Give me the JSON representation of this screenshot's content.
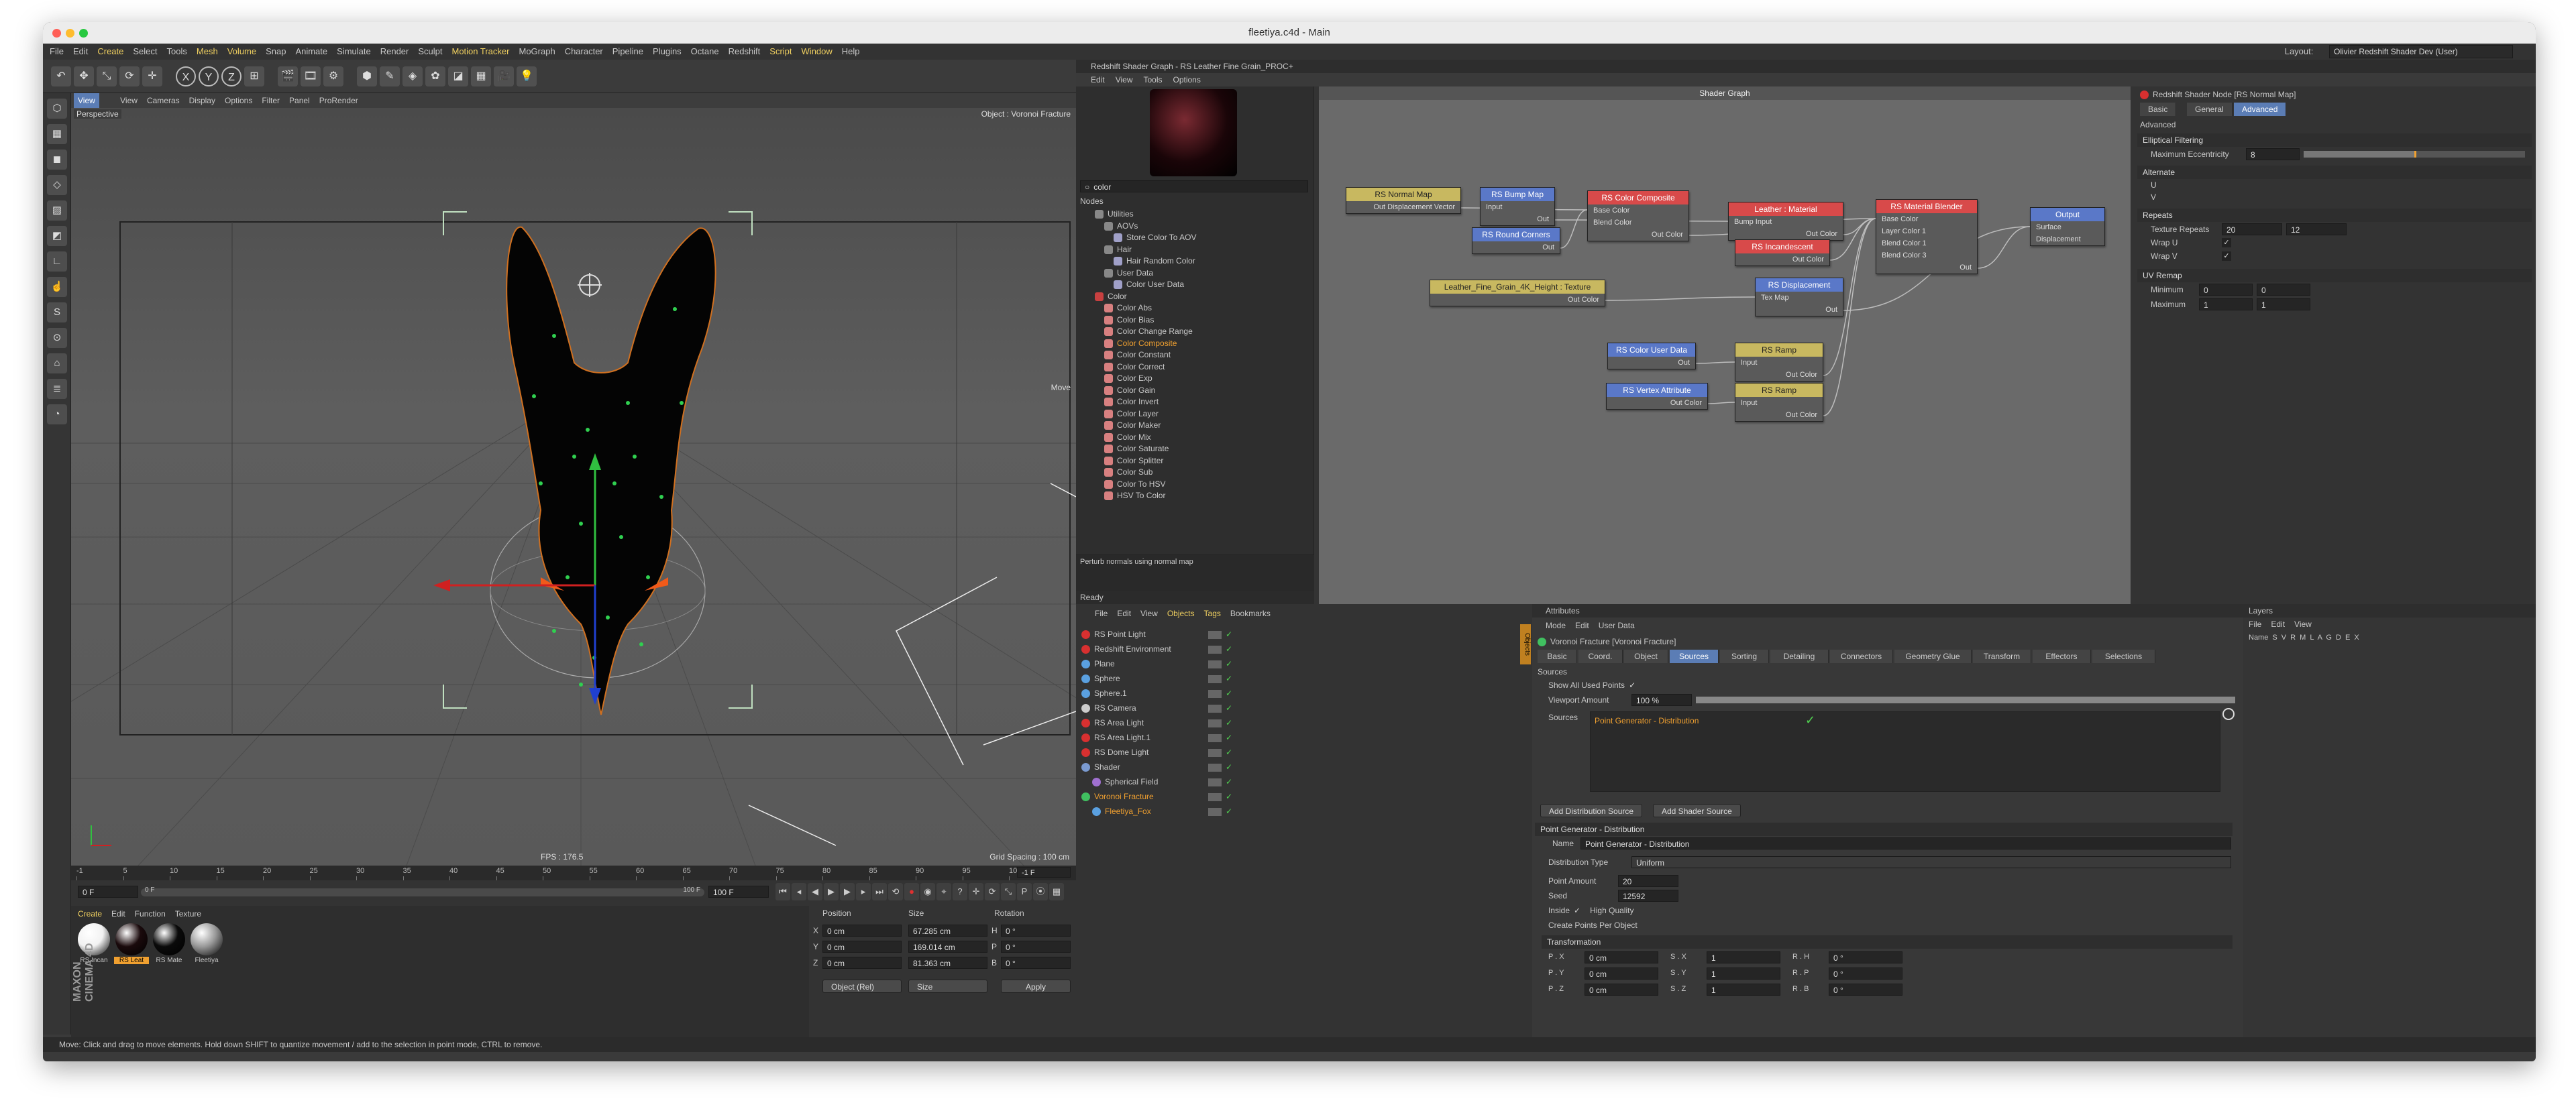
{
  "window": {
    "title": "fleetiya.c4d - Main",
    "layout_label": "Layout:",
    "layout_value": "Olivier Redshift Shader Dev (User)"
  },
  "menubar": [
    "File",
    "Edit",
    "Create",
    "Select",
    "Tools",
    "Mesh",
    "Volume",
    "Snap",
    "Animate",
    "Simulate",
    "Render",
    "Sculpt",
    "Motion Tracker",
    "MoGraph",
    "Character",
    "Pipeline",
    "Plugins",
    "Octane",
    "Redshift",
    "Script",
    "Window",
    "Help"
  ],
  "toolbar_icons": [
    "undo-icon",
    "move-icon",
    "scale-icon",
    "rotate-icon",
    "transform-icon",
    "x-axis-icon",
    "y-axis-icon",
    "z-axis-icon",
    "coordinate-icon",
    "render-view-icon",
    "render-pv-icon",
    "render-settings-icon",
    "cube-icon",
    "pen-icon",
    "subdivide-icon",
    "cloner-icon",
    "deformer-icon",
    "floor-icon",
    "camera-icon",
    "light-icon"
  ],
  "toolbar_glyphs": [
    "↶",
    "✥",
    "⤡",
    "⟳",
    "✛",
    "X",
    "Y",
    "Z",
    "⊞",
    "🎬",
    "🎞",
    "⚙",
    "⬢",
    "✎",
    "◈",
    "✿",
    "◪",
    "▦",
    "🎥",
    "💡"
  ],
  "viewport": {
    "view_tab": "View",
    "menus": [
      "View",
      "Cameras",
      "Display",
      "Options",
      "Filter",
      "Panel",
      "ProRender"
    ],
    "name": "Perspective",
    "object_label": "Object : Voronoi Fracture",
    "move_label": "Move",
    "fps": "FPS : 176.5",
    "grid_spacing": "Grid Spacing : 100 cm"
  },
  "timeline": {
    "ticks": [
      "-1",
      "5",
      "10",
      "15",
      "20",
      "25",
      "30",
      "35",
      "40",
      "45",
      "50",
      "55",
      "60",
      "65",
      "70",
      "75",
      "80",
      "85",
      "90",
      "95",
      "100"
    ],
    "current_frame": "-1 F",
    "start": "0 F",
    "range_start": "0 F",
    "range_end": "100 F",
    "end": "100 F"
  },
  "materials": {
    "menus": [
      "Create",
      "Edit",
      "Function",
      "Texture"
    ],
    "items": [
      {
        "name": "RS Incan",
        "color": "#f2f2f2"
      },
      {
        "name": "RS Leat",
        "color": "#1a0a0c"
      },
      {
        "name": "RS Mate",
        "color": "#0a0a0a"
      },
      {
        "name": "Fleetiya",
        "color": "#999999"
      }
    ]
  },
  "coordinates": {
    "headers": [
      "Position",
      "Size",
      "Rotation"
    ],
    "rows": [
      {
        "axis": "X",
        "pos": "0 cm",
        "size": "67.285 cm",
        "rot_label": "H",
        "rot": "0 °"
      },
      {
        "axis": "Y",
        "pos": "0 cm",
        "size": "169.014 cm",
        "rot_label": "P",
        "rot": "0 °"
      },
      {
        "axis": "Z",
        "pos": "0 cm",
        "size": "81.363 cm",
        "rot_label": "B",
        "rot": "0 °"
      }
    ],
    "mode": "Object (Rel)",
    "size_mode": "Size",
    "apply": "Apply"
  },
  "status": "Move: Click and drag to move elements. Hold down SHIFT to quantize movement / add to the selection in point mode, CTRL to remove.",
  "brand": "MAXON CINEMA 4D",
  "shader_graph": {
    "title": "Redshift Shader Graph - RS Leather Fine Grain_PROC+",
    "menus": [
      "Edit",
      "View",
      "Tools",
      "Options"
    ],
    "search": "color",
    "nodes_header": "Nodes",
    "tree": [
      {
        "label": "Utilities",
        "level": 1,
        "color": "#888888"
      },
      {
        "label": "AOVs",
        "level": 2,
        "color": "#888888"
      },
      {
        "label": "Store Color To AOV",
        "level": 3,
        "color": "#a0a0c8"
      },
      {
        "label": "Hair",
        "level": 2,
        "color": "#888888"
      },
      {
        "label": "Hair Random Color",
        "level": 3,
        "color": "#a0a0c8"
      },
      {
        "label": "User Data",
        "level": 2,
        "color": "#888888"
      },
      {
        "label": "Color User Data",
        "level": 3,
        "color": "#a0a0c8"
      },
      {
        "label": "Color",
        "level": 1,
        "color": "#c84040"
      },
      {
        "label": "Color Abs",
        "level": 2,
        "color": "#d88080"
      },
      {
        "label": "Color Bias",
        "level": 2,
        "color": "#d88080"
      },
      {
        "label": "Color Change Range",
        "level": 2,
        "color": "#d88080"
      },
      {
        "label": "Color Composite",
        "level": 2,
        "color": "#d88080",
        "active": true
      },
      {
        "label": "Color Constant",
        "level": 2,
        "color": "#d88080"
      },
      {
        "label": "Color Correct",
        "level": 2,
        "color": "#d88080"
      },
      {
        "label": "Color Exp",
        "level": 2,
        "color": "#d88080"
      },
      {
        "label": "Color Gain",
        "level": 2,
        "color": "#d88080"
      },
      {
        "label": "Color Invert",
        "level": 2,
        "color": "#d88080"
      },
      {
        "label": "Color Layer",
        "level": 2,
        "color": "#d88080"
      },
      {
        "label": "Color Maker",
        "level": 2,
        "color": "#d88080"
      },
      {
        "label": "Color Mix",
        "level": 2,
        "color": "#d88080"
      },
      {
        "label": "Color Saturate",
        "level": 2,
        "color": "#d88080"
      },
      {
        "label": "Color Splitter",
        "level": 2,
        "color": "#d88080"
      },
      {
        "label": "Color Sub",
        "level": 2,
        "color": "#d88080"
      },
      {
        "label": "Color To HSV",
        "level": 2,
        "color": "#d88080"
      },
      {
        "label": "HSV To Color",
        "level": 2,
        "color": "#d88080"
      }
    ],
    "description": "Perturb normals using normal map",
    "ready": "Ready",
    "graph_title": "Shader Graph",
    "nodes": [
      {
        "title": "RS Normal Map",
        "color": "#c8b860",
        "inputs": [],
        "outputs": [
          "Out Displacement Vector"
        ]
      },
      {
        "title": "RS Bump Map",
        "color": "#5a78c8",
        "inputs": [
          "Input"
        ],
        "outputs": [
          "Out"
        ]
      },
      {
        "title": "RS Round Corners",
        "color": "#5a78c8",
        "inputs": [],
        "outputs": [
          "Out"
        ]
      },
      {
        "title": "RS Color Composite",
        "color": "#d84a4a",
        "inputs": [
          "Base Color",
          "Blend Color"
        ],
        "outputs": [
          "Out Color"
        ]
      },
      {
        "title": "Leather : Material",
        "color": "#d84a4a",
        "inputs": [
          "Bump Input"
        ],
        "outputs": [
          "Out Color"
        ]
      },
      {
        "title": "RS Incandescent",
        "color": "#d84a4a",
        "inputs": [],
        "outputs": [
          "Out Color"
        ]
      },
      {
        "title": "RS Material Blender",
        "color": "#d84a4a",
        "inputs": [
          "Base Color",
          "Layer Color 1",
          "Blend Color 1",
          "Blend Color 3"
        ],
        "outputs": [
          "Out"
        ]
      },
      {
        "title": "Output",
        "color": "#5a78c8",
        "inputs": [
          "Surface",
          "Displacement"
        ],
        "outputs": []
      },
      {
        "title": "Leather_Fine_Grain_4K_Height : Texture",
        "color": "#c8b860",
        "inputs": [],
        "outputs": [
          "Out Color"
        ]
      },
      {
        "title": "RS Displacement",
        "color": "#5a78c8",
        "inputs": [
          "Tex Map"
        ],
        "outputs": [
          "Out"
        ]
      },
      {
        "title": "RS Color User Data",
        "color": "#5a78c8",
        "inputs": [],
        "outputs": [
          "Out"
        ]
      },
      {
        "title": "RS Ramp",
        "color": "#c8b860",
        "inputs": [
          "Input"
        ],
        "outputs": [
          "Out Color"
        ]
      },
      {
        "title": "RS Vertex Attribute",
        "color": "#5a78c8",
        "inputs": [],
        "outputs": [
          "Out Color"
        ]
      },
      {
        "title": "RS Ramp",
        "color": "#c8b860",
        "inputs": [
          "Input"
        ],
        "outputs": [
          "Out Color"
        ]
      }
    ]
  },
  "shader_props": {
    "title": "Redshift Shader Node [RS Normal Map]",
    "tabs": [
      "Basic",
      "General",
      "Advanced"
    ],
    "active_tab": "Advanced",
    "section": "Advanced",
    "elliptical": {
      "title": "Elliptical Filtering",
      "label": "Maximum Eccentricity",
      "value": "8",
      "level": 0.5
    },
    "alternate": {
      "title": "Alternate",
      "rows": [
        "U",
        "V"
      ]
    },
    "repeats": {
      "title": "Repeats",
      "label": "Texture Repeats",
      "u": "20",
      "v": "12",
      "wrap_u": "Wrap U",
      "wrap_v": "Wrap V"
    },
    "uv_remap": {
      "title": "UV Remap",
      "rows": [
        {
          "label": "Minimum",
          "a": "0",
          "b": "0"
        },
        {
          "label": "Maximum",
          "a": "1",
          "b": "1"
        }
      ]
    }
  },
  "objects": {
    "menus": [
      "File",
      "Edit",
      "View",
      "Objects",
      "Tags",
      "Bookmarks"
    ],
    "items": [
      {
        "name": "RS Point Light",
        "icon": "#d83030",
        "level": 0
      },
      {
        "name": "Redshift Environment",
        "icon": "#d83030",
        "level": 0
      },
      {
        "name": "Plane",
        "icon": "#5aa0e0",
        "level": 0
      },
      {
        "name": "Sphere",
        "icon": "#5aa0e0",
        "level": 0
      },
      {
        "name": "Sphere.1",
        "icon": "#5aa0e0",
        "level": 0
      },
      {
        "name": "RS Camera",
        "icon": "#cccccc",
        "level": 0
      },
      {
        "name": "RS Area Light",
        "icon": "#d83030",
        "level": 0
      },
      {
        "name": "RS Area Light.1",
        "icon": "#d83030",
        "level": 0
      },
      {
        "name": "RS Dome Light",
        "icon": "#d83030",
        "level": 0
      },
      {
        "name": "Shader",
        "icon": "#7a9ad0",
        "level": 0
      },
      {
        "name": "Spherical Field",
        "icon": "#a070d0",
        "level": 1
      },
      {
        "name": "Voronoi Fracture",
        "icon": "#40c060",
        "level": 0,
        "selected": true
      },
      {
        "name": "Fleetiya_Fox",
        "icon": "#5aa0e0",
        "level": 1,
        "selected": true
      }
    ],
    "side_tab": "Objects"
  },
  "attributes": {
    "header": "Attributes",
    "menus": [
      "Mode",
      "Edit",
      "User Data"
    ],
    "object": "Voronoi Fracture [Voronoi Fracture]",
    "tabs": [
      "Basic",
      "Coord.",
      "Object",
      "Sources",
      "Sorting",
      "Detailing",
      "Connectors",
      "Geometry Glue",
      "Transform",
      "Effectors",
      "Selections"
    ],
    "active_tab": "Sources",
    "sources_title": "Sources",
    "show_used": "Show All Used Points",
    "viewport_amount_label": "Viewport Amount",
    "viewport_amount": "100 %",
    "sources_label": "Sources",
    "source_item": "Point Generator - Distribution",
    "add_distribution": "Add Distribution Source",
    "add_shader": "Add Shader Source",
    "pg_title": "Point Generator - Distribution",
    "name_label": "Name",
    "name_value": "Point Generator - Distribution",
    "dist_label": "Distribution Type",
    "dist_value": "Uniform",
    "point_amount_label": "Point Amount",
    "point_amount": "20",
    "seed_label": "Seed",
    "seed": "12592",
    "inside_label": "Inside",
    "high_quality_label": "High Quality",
    "create_points_label": "Create Points Per Object",
    "transformation": "Transformation",
    "transform_rows": [
      {
        "p": "P . X",
        "pv": "0 cm",
        "s": "S . X",
        "sv": "1",
        "r": "R . H",
        "rv": "0 °"
      },
      {
        "p": "P . Y",
        "pv": "0 cm",
        "s": "S . Y",
        "sv": "1",
        "r": "R . P",
        "rv": "0 °"
      },
      {
        "p": "P . Z",
        "pv": "0 cm",
        "s": "S . Z",
        "sv": "1",
        "r": "R . B",
        "rv": "0 °"
      }
    ]
  },
  "layers": {
    "header": "Layers",
    "menus": [
      "File",
      "Edit",
      "View"
    ],
    "columns": "Name   S  V  R  M  L  A  G  D  E  X"
  },
  "colors": {
    "accent": "#5b7db5",
    "highlight": "#f0a030",
    "selected_text": "#f0a030",
    "viewport_bg": "#555555"
  }
}
